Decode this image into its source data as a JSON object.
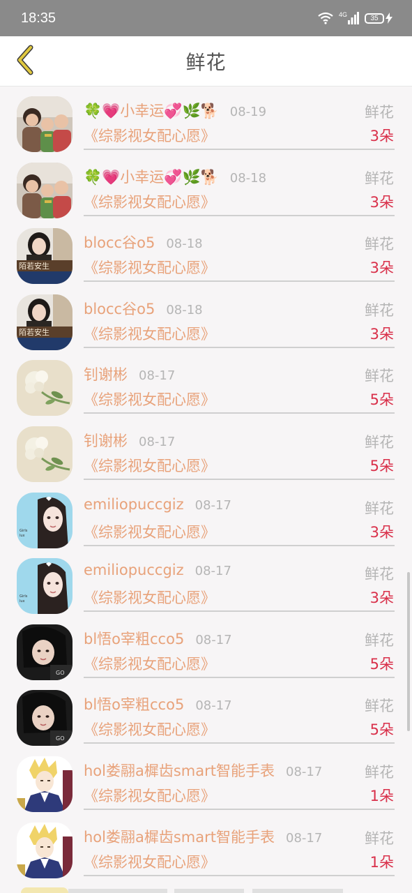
{
  "status_bar": {
    "time": "18:35",
    "network": "4G",
    "battery": "35"
  },
  "header": {
    "title": "鲜花"
  },
  "rows": [
    {
      "name": "🍀💗小幸运💞🌿🐕",
      "date": "08-19",
      "type": "鲜花",
      "book": "《综影视女配心愿》",
      "count": "3朵",
      "avatar": "avatar-kids"
    },
    {
      "name": "🍀💗小幸运💞🌿🐕",
      "date": "08-18",
      "type": "鲜花",
      "book": "《综影视女配心愿》",
      "count": "3朵",
      "avatar": "avatar-kids"
    },
    {
      "name": "blocc谷o5",
      "date": "08-18",
      "type": "鲜花",
      "book": "《综影视女配心愿》",
      "count": "3朵",
      "avatar": "avatar-woman-banner"
    },
    {
      "name": "blocc谷o5",
      "date": "08-18",
      "type": "鲜花",
      "book": "《综影视女配心愿》",
      "count": "3朵",
      "avatar": "avatar-woman-banner"
    },
    {
      "name": "钊谢彬",
      "date": "08-17",
      "type": "鲜花",
      "book": "《综影视女配心愿》",
      "count": "5朵",
      "avatar": "avatar-flower"
    },
    {
      "name": "钊谢彬",
      "date": "08-17",
      "type": "鲜花",
      "book": "《综影视女配心愿》",
      "count": "5朵",
      "avatar": "avatar-flower"
    },
    {
      "name": "emiliopuccgiz",
      "date": "08-17",
      "type": "鲜花",
      "book": "《综影视女配心愿》",
      "count": "3朵",
      "avatar": "avatar-drawn-girl"
    },
    {
      "name": "emiliopuccgiz",
      "date": "08-17",
      "type": "鲜花",
      "book": "《综影视女配心愿》",
      "count": "3朵",
      "avatar": "avatar-drawn-girl"
    },
    {
      "name": "bl悟o宰粗cco5",
      "date": "08-17",
      "type": "鲜花",
      "book": "《综影视女配心愿》",
      "count": "5朵",
      "avatar": "avatar-dark-woman"
    },
    {
      "name": "bl悟o宰粗cco5",
      "date": "08-17",
      "type": "鲜花",
      "book": "《综影视女配心愿》",
      "count": "5朵",
      "avatar": "avatar-dark-woman"
    },
    {
      "name": "hol娄翮a樨齿smart智能手表",
      "date": "08-17",
      "type": "鲜花",
      "book": "《综影视女配心愿》",
      "count": "1朵",
      "avatar": "avatar-anime-blond"
    },
    {
      "name": "hol娄翮a樨齿smart智能手表",
      "date": "08-17",
      "type": "鲜花",
      "book": "《综影视女配心愿》",
      "count": "1朵",
      "avatar": "avatar-anime-blond"
    }
  ],
  "colors": {
    "accent_orange": "#e8a27a",
    "count_red": "#d9304a",
    "back_arrow": "#e0c840",
    "status_bar": "#8a8a8a"
  }
}
